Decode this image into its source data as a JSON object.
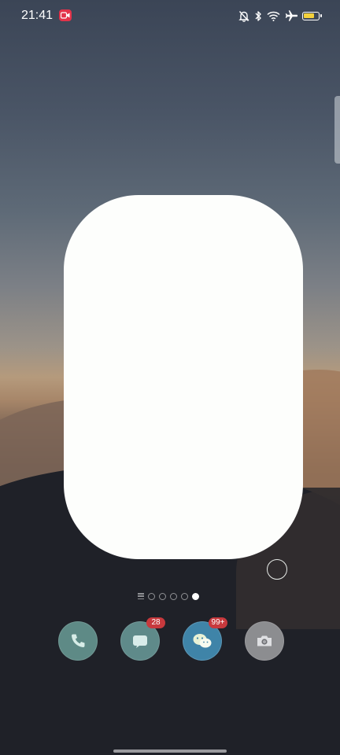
{
  "status_bar": {
    "time": "21:41",
    "icons": [
      "screen-record-icon",
      "mute-bell-icon",
      "bluetooth-icon",
      "wifi-icon",
      "airplane-icon",
      "battery-icon"
    ],
    "battery_level": 0.75,
    "battery_color": "#f4d13b",
    "record_color": "#e2334a"
  },
  "page_indicator": {
    "pages": 5,
    "active_page": 5
  },
  "dock": {
    "apps": [
      {
        "name": "phone",
        "icon": "phone-icon",
        "badge": ""
      },
      {
        "name": "messages",
        "icon": "message-icon",
        "badge": "28"
      },
      {
        "name": "wechat",
        "icon": "wechat-icon",
        "badge": "99+"
      },
      {
        "name": "camera",
        "icon": "camera-icon",
        "badge": ""
      }
    ]
  }
}
